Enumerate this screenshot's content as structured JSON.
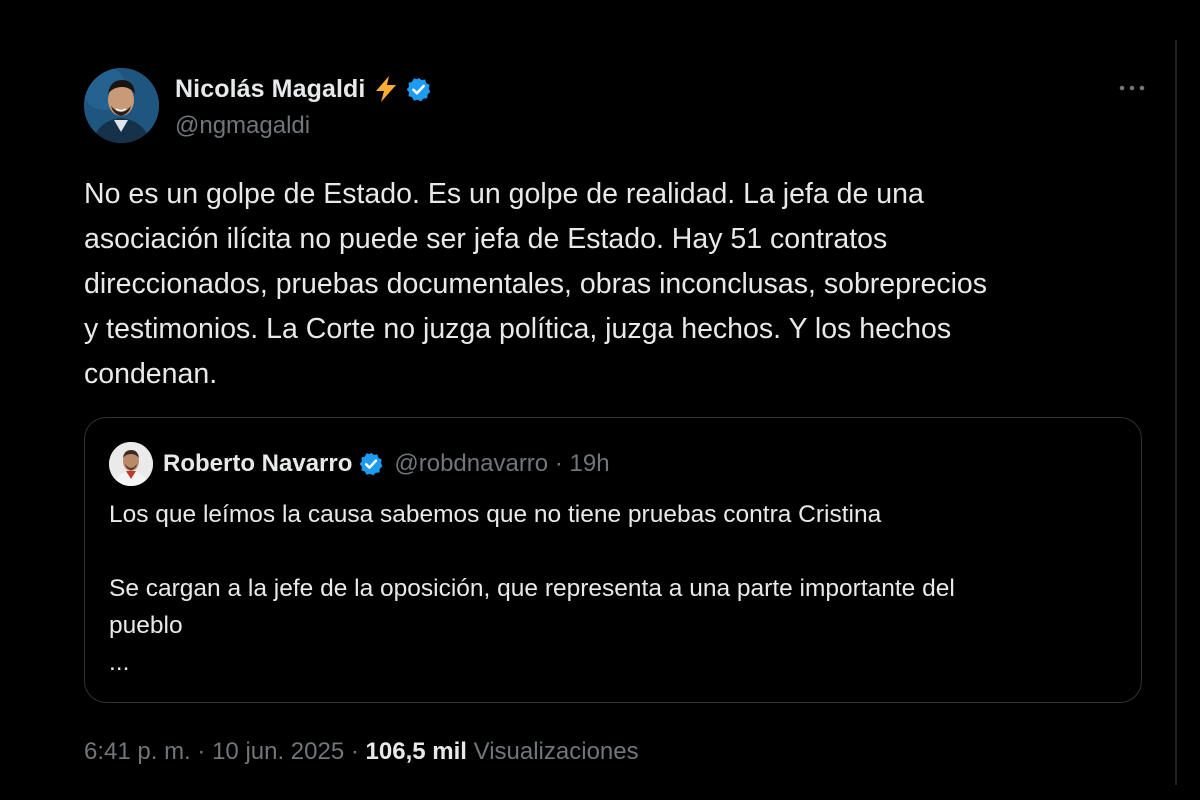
{
  "tweet": {
    "author": {
      "display_name": "Nicolás Magaldi",
      "handle": "@ngmagaldi",
      "emoji": "bolt-emoji",
      "verified": true,
      "verified_color": "#1d9bf0"
    },
    "more_icon": "more-horizontal-icon",
    "text_lines": [
      "No es un golpe de Estado. Es un golpe de realidad. La jefa de una",
      "asociación ilícita no puede ser jefa de Estado. Hay 51 contratos",
      "direccionados, pruebas documentales, obras inconclusas, sobreprecios",
      "y testimonios. La Corte no juzga política, juzga hechos. Y los hechos",
      "condenan."
    ],
    "quoted": {
      "display_name": "Roberto Navarro",
      "handle": "@robdnavarro",
      "separator": "·",
      "time": "19h",
      "verified": true,
      "paragraph_1": "Los que leímos la causa sabemos que no tiene pruebas contra Cristina",
      "paragraph_2_lines": [
        "Se cargan a la jefe de la oposición, que representa a una parte importante del",
        "pueblo"
      ],
      "truncation": "..."
    },
    "footer": {
      "time": "6:41 p. m.",
      "separator": "·",
      "date": "10 jun. 2025",
      "views_count": "106,5 mil",
      "views_label": "Visualizaciones"
    }
  },
  "colors": {
    "background": "#000000",
    "text_primary": "#e7e9ea",
    "text_secondary": "#71767b",
    "border": "#2f3336",
    "verified_blue": "#1d9bf0",
    "bolt_yellow": "#ffac33"
  }
}
